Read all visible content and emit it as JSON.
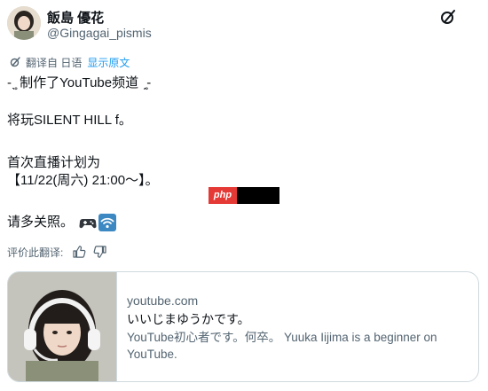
{
  "author": {
    "display_name": "飯島 優花",
    "handle": "@Gingagai_pismis"
  },
  "translation": {
    "label": "翻译自 日语",
    "show_original": "显示原文"
  },
  "tweet": {
    "lines": [
      "-ˎ̥ 制作了YouTube频道 ˏ̥-",
      "将玩SILENT HILL f。",
      "首次直播计划为",
      "【11/22(周六) 21:00〜】。",
      "请多关照。"
    ],
    "emojis": [
      "game-controller-icon",
      "wifi-signal-icon"
    ]
  },
  "watermark": {
    "text": "php"
  },
  "rate": {
    "label": "评价此翻译:"
  },
  "link_card": {
    "domain": "youtube.com",
    "title": "いいじまゆうかです。",
    "description": "YouTube初心者です。何卒。 Yuuka Iijima is a beginner on YouTube."
  },
  "colors": {
    "link": "#1d9bf0",
    "secondary_text": "#536471",
    "primary_text": "#0f1419",
    "border": "#cfd9de"
  }
}
